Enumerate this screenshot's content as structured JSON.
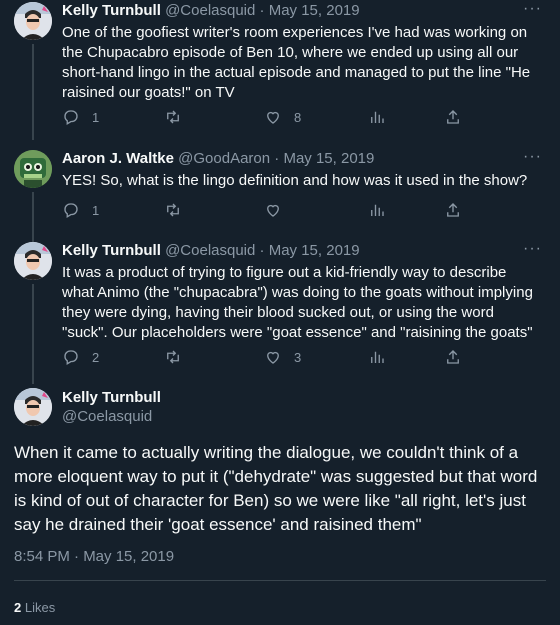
{
  "tweets": [
    {
      "name": "Kelly Turnbull",
      "handle": "@Coelasquid",
      "sep": " · ",
      "date": "May 15, 2019",
      "text": "One of the goofiest writer's room experiences I've had was working on the Chupacabro episode of Ben 10, where we ended up using all our short-hand lingo in the actual episode and managed to put the line \"He raisined our goats!\" on TV",
      "replies": "1",
      "retweets": "",
      "likes": "8"
    },
    {
      "name": "Aaron J. Waltke",
      "handle": "@GoodAaron",
      "sep": " · ",
      "date": "May 15, 2019",
      "text": "YES! So, what is the lingo definition and how was it used in the show?",
      "replies": "1",
      "retweets": "",
      "likes": ""
    },
    {
      "name": "Kelly Turnbull",
      "handle": "@Coelasquid",
      "sep": " · ",
      "date": "May 15, 2019",
      "text": "It was a product of trying to figure out a kid-friendly way to describe what Animo (the \"chupacabra\") was doing to the goats without implying they were dying, having their blood sucked out, or using the word \"suck\". Our placeholders were \"goat essence\" and \"raisining the goats\"",
      "replies": "2",
      "retweets": "",
      "likes": "3"
    }
  ],
  "main": {
    "name": "Kelly Turnbull",
    "handle": "@Coelasquid",
    "text": "When it came to actually writing the dialogue, we couldn't think of a more eloquent way to put it (\"dehydrate\" was suggested but that word is kind of out of character for Ben) so we were like \"all right, let's just say he drained their 'goat essence' and raisined them\"",
    "timestamp": "8:54 PM · May 15, 2019",
    "likes_count": "2",
    "likes_label": "Likes"
  },
  "icons": [
    "more-icon",
    "reply-icon",
    "retweet-icon",
    "like-icon",
    "views-icon",
    "share-icon"
  ],
  "colors": {
    "background": "#15202b",
    "text": "#f7f9f9",
    "muted": "#8b98a5",
    "line": "#38444d"
  }
}
